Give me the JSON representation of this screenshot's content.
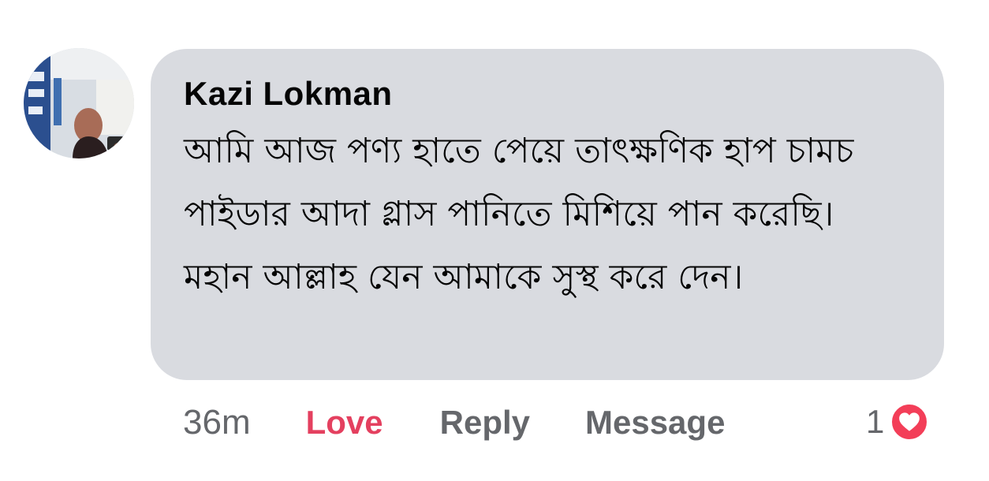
{
  "comment": {
    "author": "Kazi Lokman",
    "text": "আমি আজ পণ্য হাতে পেয়ে তাৎক্ষণিক হাপ চামচ পাইডার আদা গ্লাস পানিতে মিশিয়ে পান করেছি। মহান আল্লাহ যেন আমাকে সুস্থ করে দেন।",
    "bubble_color": "#d9dbe0"
  },
  "actions": {
    "time": "36m",
    "love_label": "Love",
    "reply_label": "Reply",
    "message_label": "Message",
    "love_color": "#e4405f",
    "muted_color": "#65676b"
  },
  "reaction": {
    "count": "1",
    "icon": "heart-icon",
    "badge_color": "#f33e58"
  }
}
